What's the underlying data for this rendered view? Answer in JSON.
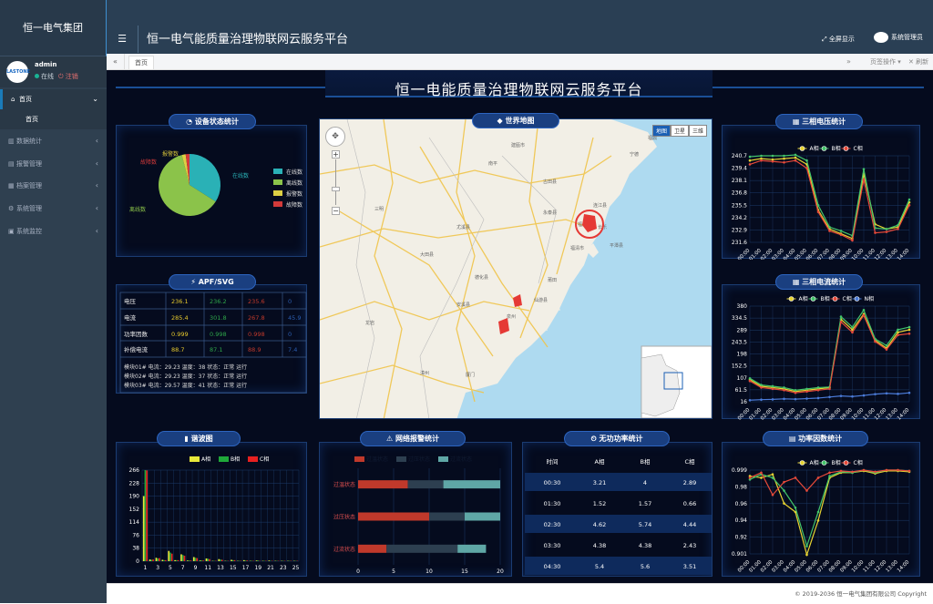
{
  "sidebar": {
    "brand": "恒一电气集团",
    "avatar_text": "LASTONE",
    "user": "admin",
    "online": "在线",
    "logout": "注销",
    "items": [
      {
        "label": "首页"
      },
      {
        "label": "首页"
      },
      {
        "label": "数据统计"
      },
      {
        "label": "报警管理"
      },
      {
        "label": "档案管理"
      },
      {
        "label": "系统管理"
      },
      {
        "label": "系统监控"
      }
    ]
  },
  "header": {
    "title": "恒一电气能质量治理物联网云服务平台",
    "fullscreen": "全屏显示",
    "admin": "系统管理员"
  },
  "tabs": {
    "home": "首页",
    "page_ops": "页签操作",
    "refresh": "刷新"
  },
  "dashboard": {
    "title": "恒一电能质量治理物联网云服务平台"
  },
  "device_status": {
    "title": "设备状态统计",
    "legend": [
      "在线数",
      "离线数",
      "报警数",
      "故障数"
    ],
    "labels": {
      "online": "在线数",
      "offline": "离线数",
      "alarm": "报警数",
      "fault": "故障数"
    },
    "colors": [
      "#2ab1b6",
      "#8bc34a",
      "#ddcf44",
      "#d43a3a"
    ],
    "chart_data": {
      "type": "pie",
      "labels": [
        "在线数",
        "离线数",
        "报警数",
        "故障数"
      ],
      "values": [
        34,
        62,
        2,
        2
      ]
    }
  },
  "apf": {
    "title": "APF/SVG",
    "rows": [
      {
        "name": "电压",
        "a": "236.1",
        "b": "236.2",
        "c": "235.6",
        "n": "0"
      },
      {
        "name": "电流",
        "a": "285.4",
        "b": "301.8",
        "c": "267.8",
        "n": "45.9"
      },
      {
        "name": "功率因数",
        "a": "0.999",
        "b": "0.998",
        "c": "0.998",
        "n": "0"
      },
      {
        "name": "补偿电流",
        "a": "88.7",
        "b": "87.1",
        "c": "88.9",
        "n": "7.4"
      }
    ],
    "modules": [
      "模块01#  电流：29.23  温度：38  状态：正常  运行",
      "模块02#  电流：29.23  温度：37  状态：正常  运行",
      "模块03#  电流：29.57  温度：41  状态：正常  运行"
    ]
  },
  "map": {
    "title": "世界地图",
    "map_btn": "地图",
    "satellite_btn": "卫星",
    "terrain_btn": "三维",
    "places": [
      "福州",
      "南平",
      "永泰县",
      "尤溪县",
      "大田县",
      "莆田",
      "泉州",
      "厦门",
      "德化县",
      "安溪县",
      "仙游县",
      "漳州",
      "龙岩",
      "平潭县",
      "福清市",
      "连江县",
      "福鼎",
      "宁德",
      "建瓯市",
      "三明",
      "古田县",
      "长乐"
    ]
  },
  "voltage": {
    "title": "三相电压统计",
    "legend": [
      "A相",
      "B相",
      "C相"
    ],
    "colors": [
      "#e8d431",
      "#43c46a",
      "#e84a3a"
    ],
    "chart_data": {
      "type": "line",
      "x": [
        "00:00",
        "01:00",
        "02:00",
        "03:00",
        "04:00",
        "05:00",
        "06:00",
        "07:00",
        "08:00",
        "09:00",
        "10:00",
        "11:00",
        "12:00",
        "13:00",
        "14:00"
      ],
      "ylim": [
        231.6,
        240.7
      ],
      "yticks": [
        "240.7",
        "239.4",
        "238.1",
        "236.8",
        "235.5",
        "234.2",
        "232.9",
        "231.6"
      ],
      "series": [
        {
          "name": "A相",
          "values": [
            240.2,
            240.4,
            240.3,
            240.4,
            240.5,
            239.8,
            235.0,
            233.0,
            232.5,
            232.0,
            238.8,
            233.5,
            233.0,
            233.2,
            235.8
          ]
        },
        {
          "name": "B相",
          "values": [
            240.6,
            240.7,
            240.7,
            240.7,
            240.8,
            240.2,
            235.5,
            233.2,
            232.8,
            232.3,
            239.3,
            233.1,
            233.0,
            233.4,
            236.1
          ]
        },
        {
          "name": "C相",
          "values": [
            239.8,
            240.2,
            240.1,
            240.0,
            240.2,
            239.4,
            234.8,
            232.8,
            232.4,
            231.8,
            238.2,
            232.6,
            232.7,
            233.0,
            235.5
          ]
        }
      ]
    }
  },
  "current": {
    "title": "三相电流统计",
    "legend": [
      "A相",
      "B相",
      "C相",
      "N相"
    ],
    "colors": [
      "#e8d431",
      "#43c46a",
      "#e84a3a",
      "#4b7bd8"
    ],
    "chart_data": {
      "type": "line",
      "x": [
        "00:00",
        "01:00",
        "02:00",
        "03:00",
        "04:00",
        "05:00",
        "06:00",
        "07:00",
        "08:00",
        "09:00",
        "10:00",
        "11:00",
        "12:00",
        "13:00",
        "14:00"
      ],
      "ylim": [
        16,
        380
      ],
      "yticks": [
        "380",
        "334.5",
        "289",
        "243.5",
        "198",
        "152.5",
        "107",
        "61.5",
        "16"
      ],
      "series": [
        {
          "name": "A相",
          "values": [
            100,
            75,
            70,
            65,
            55,
            60,
            65,
            70,
            330,
            290,
            350,
            250,
            220,
            280,
            290
          ]
        },
        {
          "name": "B相",
          "values": [
            105,
            80,
            75,
            70,
            60,
            65,
            70,
            72,
            340,
            300,
            365,
            255,
            230,
            290,
            300
          ]
        },
        {
          "name": "C相",
          "values": [
            95,
            70,
            65,
            60,
            50,
            55,
            60,
            65,
            320,
            280,
            345,
            245,
            215,
            270,
            275
          ]
        },
        {
          "name": "N相",
          "values": [
            22,
            24,
            25,
            27,
            26,
            28,
            30,
            34,
            38,
            36,
            40,
            45,
            48,
            46,
            50
          ]
        }
      ]
    }
  },
  "harmonic": {
    "title": "谐波图",
    "legend": [
      "A相",
      "B相",
      "C相"
    ],
    "colors": [
      "#e8e83a",
      "#1fa83a",
      "#e82020"
    ],
    "chart_data": {
      "type": "bar",
      "categories": [
        "1",
        "2",
        "3",
        "4",
        "5",
        "6",
        "7",
        "8",
        "9",
        "10",
        "11",
        "12",
        "13",
        "14",
        "15",
        "16",
        "17",
        "18",
        "19",
        "20",
        "21",
        "22",
        "23",
        "24",
        "25"
      ],
      "ylim": [
        0,
        266
      ],
      "yticks": [
        "266",
        "228",
        "190",
        "152",
        "114",
        "76",
        "38",
        "0"
      ],
      "xticks": [
        "1",
        "3",
        "5",
        "7",
        "9",
        "11",
        "13",
        "15",
        "17",
        "19",
        "21",
        "23",
        "25"
      ],
      "series": [
        {
          "name": "A相",
          "values": [
            190,
            5,
            10,
            4,
            30,
            3,
            20,
            2,
            12,
            2,
            8,
            1,
            6,
            1,
            4,
            1,
            3,
            1,
            2,
            1,
            2,
            1,
            1,
            1,
            1
          ]
        },
        {
          "name": "B相",
          "values": [
            280,
            4,
            8,
            3,
            25,
            3,
            18,
            2,
            10,
            2,
            7,
            1,
            5,
            1,
            3,
            1,
            2,
            1,
            2,
            1,
            1,
            1,
            1,
            1,
            1
          ]
        },
        {
          "name": "C相",
          "values": [
            265,
            5,
            9,
            3,
            22,
            3,
            16,
            2,
            9,
            2,
            6,
            1,
            4,
            1,
            3,
            1,
            2,
            1,
            1,
            1,
            1,
            1,
            1,
            1,
            1
          ]
        }
      ]
    }
  },
  "network": {
    "title": "网络报警统计",
    "legend": [
      "过温状态",
      "过压状态",
      "过流状态"
    ],
    "colors": [
      "#c0392b",
      "#2d3f50",
      "#5fa7a6"
    ],
    "chart_data": {
      "type": "bar",
      "categories": [
        "过温状态",
        "过压状态",
        "过流状态"
      ],
      "xlim": [
        0,
        20
      ],
      "xticks": [
        "0",
        "5",
        "10",
        "15",
        "20"
      ],
      "series": [
        {
          "name": "过温状态",
          "values": [
            7,
            10,
            4
          ]
        },
        {
          "name": "过压状态",
          "values": [
            5,
            5,
            10
          ]
        },
        {
          "name": "过流状态",
          "values": [
            8,
            5,
            4
          ]
        }
      ]
    }
  },
  "reactive": {
    "title": "无功功率统计",
    "headers": [
      "时间",
      "A相",
      "B相",
      "C相"
    ],
    "rows": [
      [
        "00:30",
        "3.21",
        "4",
        "2.89"
      ],
      [
        "01:30",
        "1.52",
        "1.57",
        "0.66"
      ],
      [
        "02:30",
        "4.62",
        "5.74",
        "4.44"
      ],
      [
        "03:30",
        "4.38",
        "4.38",
        "2.43"
      ],
      [
        "04:30",
        "5.4",
        "5.6",
        "3.51"
      ]
    ]
  },
  "pf": {
    "title": "功率因数统计",
    "legend": [
      "A相",
      "B相",
      "C相"
    ],
    "colors": [
      "#e8d431",
      "#43c46a",
      "#e84a3a"
    ],
    "chart_data": {
      "type": "line",
      "x": [
        "00:00",
        "01:00",
        "02:00",
        "03:00",
        "04:00",
        "05:00",
        "06:00",
        "07:00",
        "08:00",
        "09:00",
        "10:00",
        "11:00",
        "12:00",
        "13:00",
        "14:00"
      ],
      "ylim": [
        0.901,
        0.999
      ],
      "yticks": [
        "0.999",
        "0.98",
        "0.96",
        "0.94",
        "0.92",
        "0.901"
      ],
      "series": [
        {
          "name": "A相",
          "values": [
            0.992,
            0.99,
            0.994,
            0.96,
            0.95,
            0.9,
            0.94,
            0.99,
            0.996,
            0.996,
            0.998,
            0.995,
            0.998,
            0.998,
            0.997
          ]
        },
        {
          "name": "B相",
          "values": [
            0.988,
            0.994,
            0.99,
            0.975,
            0.955,
            0.91,
            0.95,
            0.992,
            0.997,
            0.996,
            0.999,
            0.996,
            0.999,
            0.999,
            0.998
          ]
        },
        {
          "name": "C相",
          "values": [
            0.99,
            0.996,
            0.97,
            0.985,
            0.99,
            0.975,
            0.99,
            0.996,
            0.998,
            0.997,
            0.999,
            0.997,
            0.999,
            0.999,
            0.998
          ]
        }
      ]
    }
  },
  "footer": {
    "text": "© 2019-2036 恒一电气集团有限公司 Copyright"
  }
}
